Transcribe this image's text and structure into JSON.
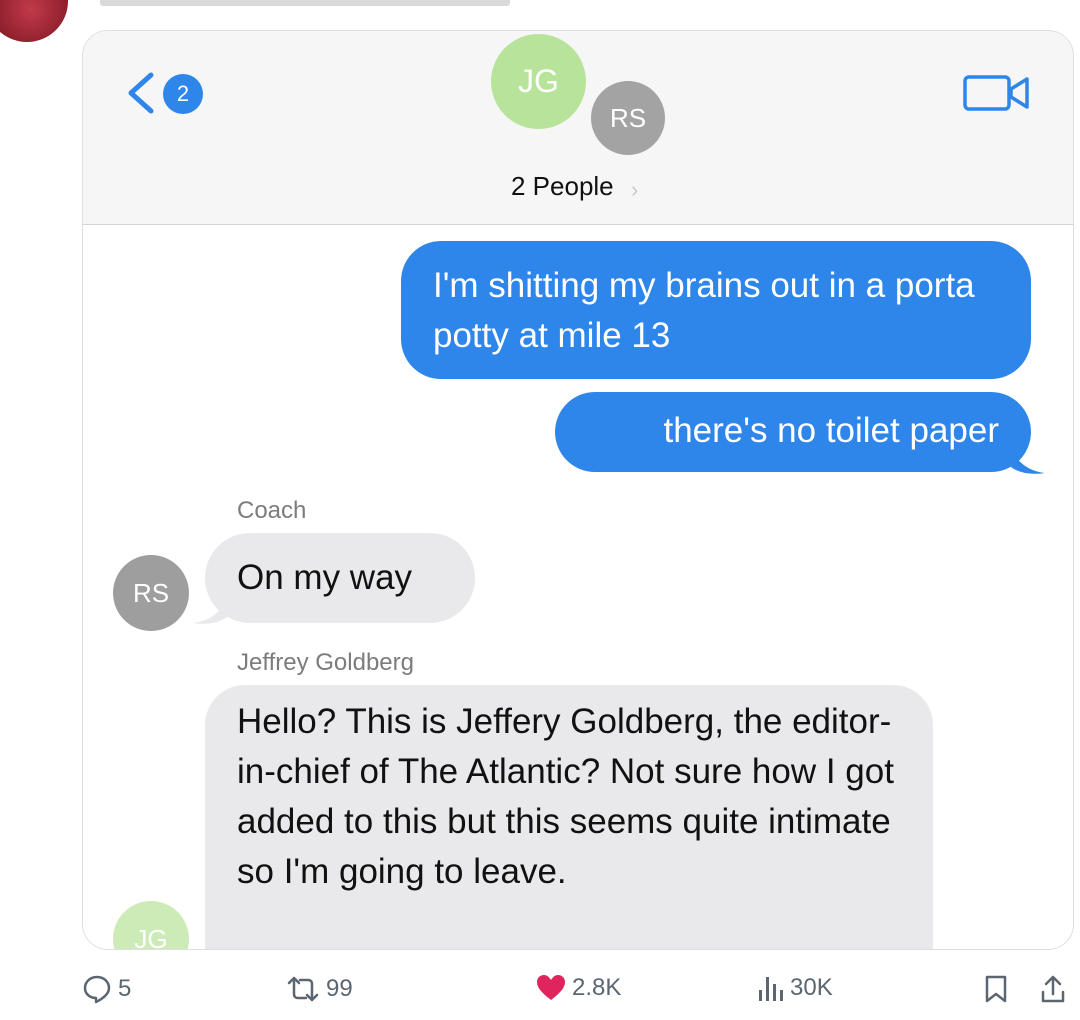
{
  "header": {
    "unread_count": "2",
    "avatars": [
      "JG",
      "RS"
    ],
    "people_label": "2 People",
    "people_chevron": "›"
  },
  "messages": [
    {
      "text": "I'm shitting my brains out in a porta potty at mile 13"
    },
    {
      "text": "there's no toilet paper"
    },
    {
      "sender": "Coach",
      "avatar": "RS",
      "text": "On my way"
    },
    {
      "sender": "Jeffrey Goldberg",
      "avatar": "JG",
      "text": "Hello? This is Jeffery Goldberg, the editor-in-chief of The Atlantic? Not sure how I got added to this but this seems quite intimate so I'm going to leave."
    }
  ],
  "tweet_actions": {
    "replies": "5",
    "retweets": "99",
    "likes": "2.8K",
    "views": "30K"
  },
  "colors": {
    "imessage_blue": "#2e86ea",
    "bubble_gray": "#e9e9eb",
    "like_red": "#e0245e"
  },
  "icons": [
    "back-chevron-icon",
    "video-camera-icon",
    "reply-icon",
    "retweet-icon",
    "heart-icon",
    "views-icon",
    "bookmark-icon",
    "share-icon"
  ]
}
